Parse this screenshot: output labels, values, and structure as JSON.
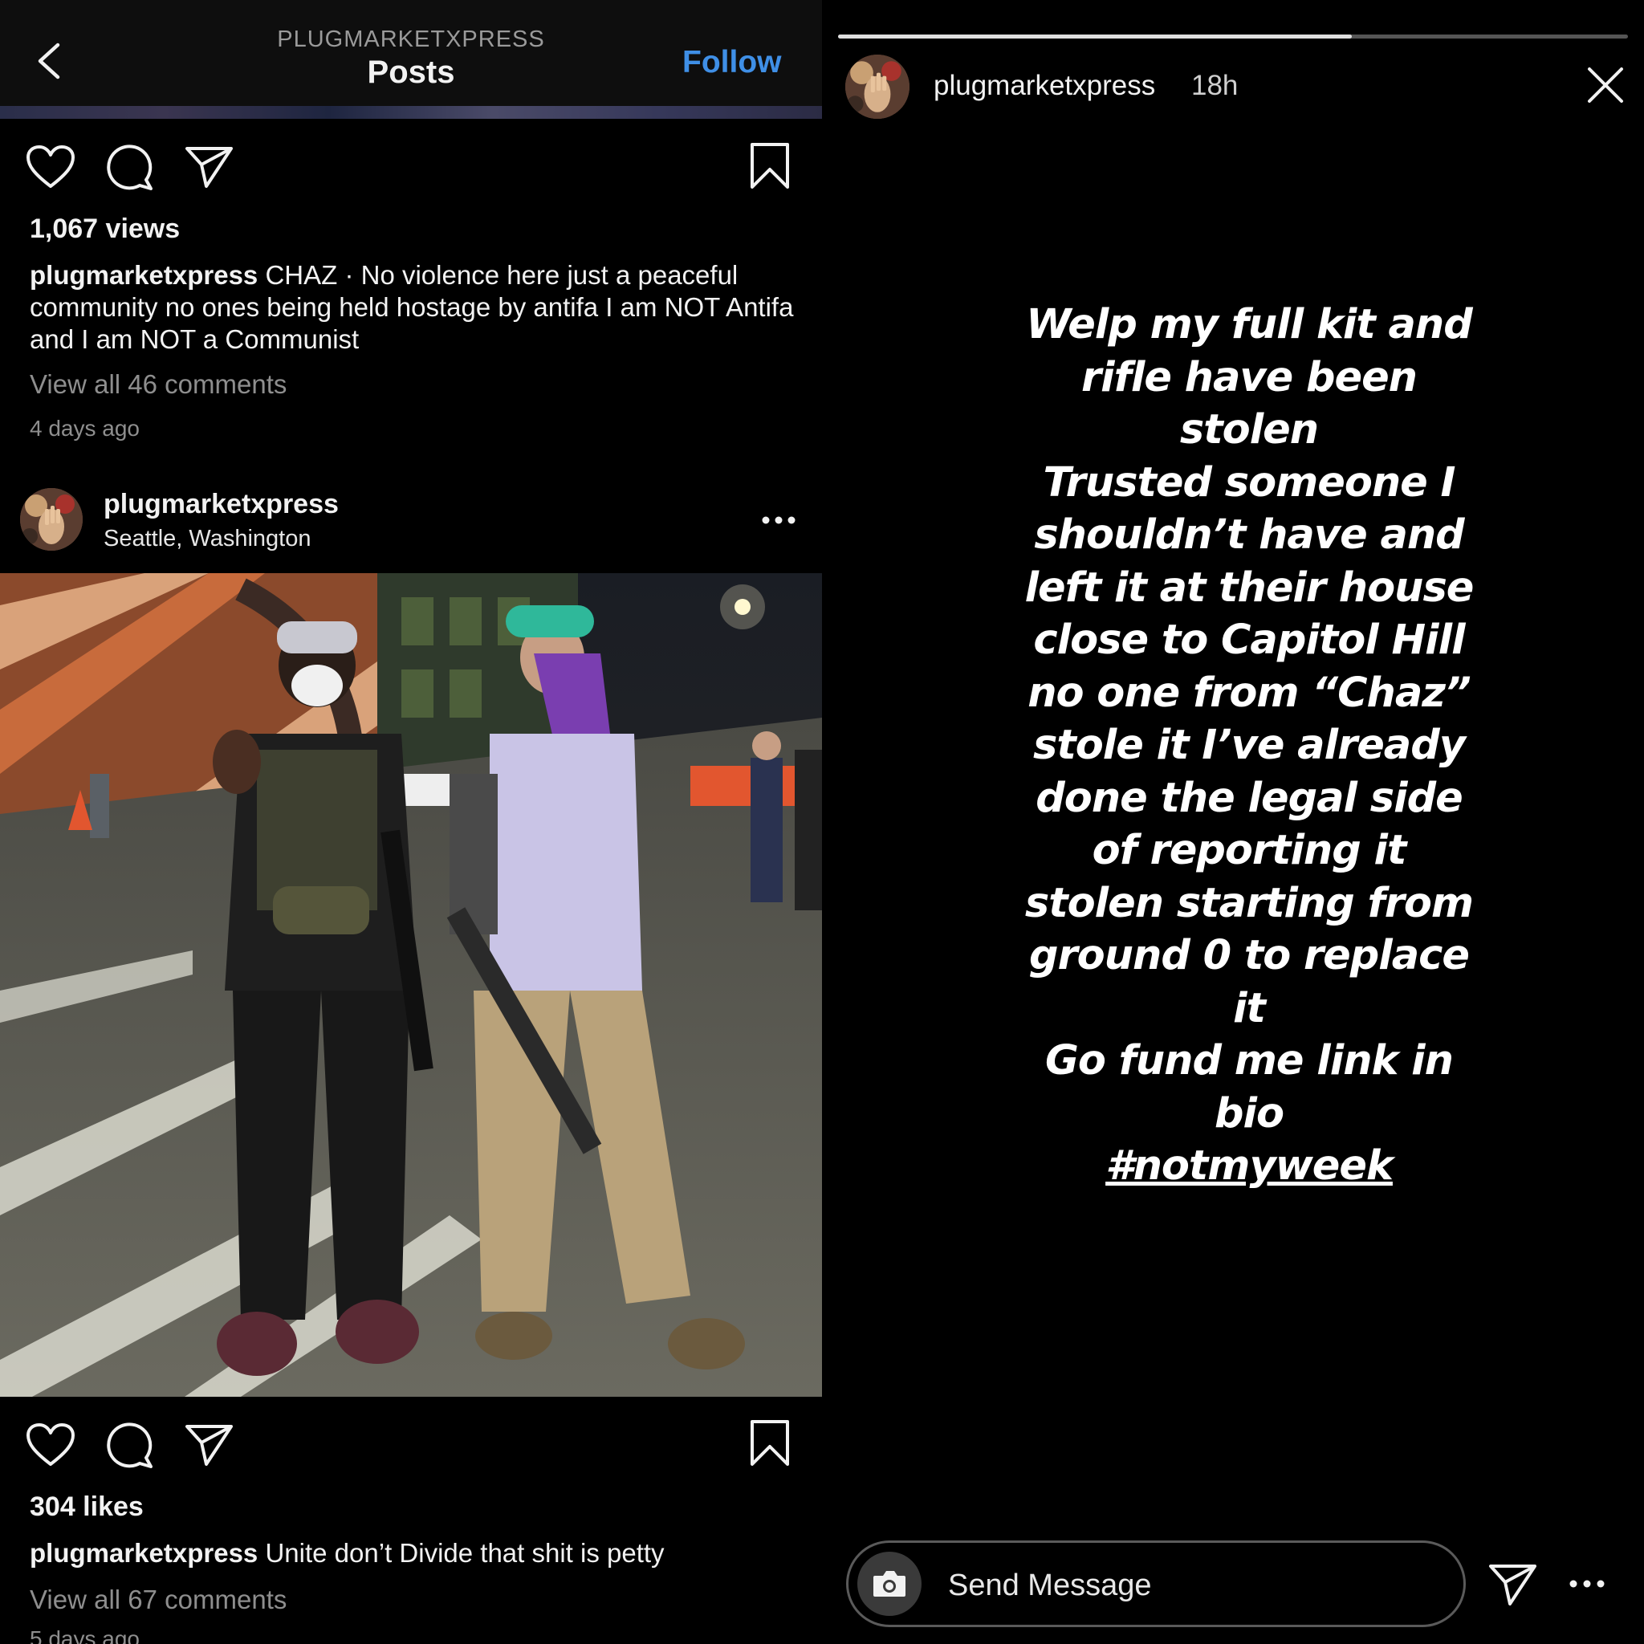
{
  "feed": {
    "header": {
      "account": "PLUGMARKETXPRESS",
      "title": "Posts",
      "follow_label": "Follow"
    },
    "post1": {
      "views": "1,067 views",
      "caption_user": "plugmarketxpress",
      "caption_text": "CHAZ · No violence here just a peaceful community no ones being held hostage by antifa I am NOT Antifa and I am NOT a Communist",
      "view_comments": "View all 46 comments",
      "time_ago": "4 days ago"
    },
    "post2": {
      "username": "plugmarketxpress",
      "location": "Seattle, Washington",
      "likes": "304 likes",
      "caption_user": "plugmarketxpress",
      "caption_text": "Unite don’t Divide that shit is petty",
      "view_comments": "View all 67 comments",
      "time_ago": "5 days ago"
    },
    "icons": [
      "back-icon",
      "heart-icon",
      "comment-icon",
      "share-icon",
      "bookmark-icon",
      "more-icon"
    ]
  },
  "story": {
    "progress": 0.65,
    "username": "plugmarketxpress",
    "time": "18h",
    "text_lines": [
      "Welp my full kit and",
      "rifle  have been",
      "stolen",
      "Trusted someone I",
      "shouldn’t have and",
      "left it at their house",
      "close to Capitol Hill",
      "no one from “Chaz”",
      "stole it I’ve already",
      "done the legal side",
      "of reporting it",
      "stolen starting from",
      "ground 0 to replace",
      "it",
      "Go fund me link in",
      "bio"
    ],
    "hashtag": "#notmyweek",
    "message_placeholder": "Send Message",
    "icons": [
      "close-icon",
      "camera-icon",
      "send-icon",
      "more-icon"
    ]
  },
  "colors": {
    "follow": "#3f8fe6",
    "secondary_text": "#8e8e8e",
    "background": "#000000"
  }
}
